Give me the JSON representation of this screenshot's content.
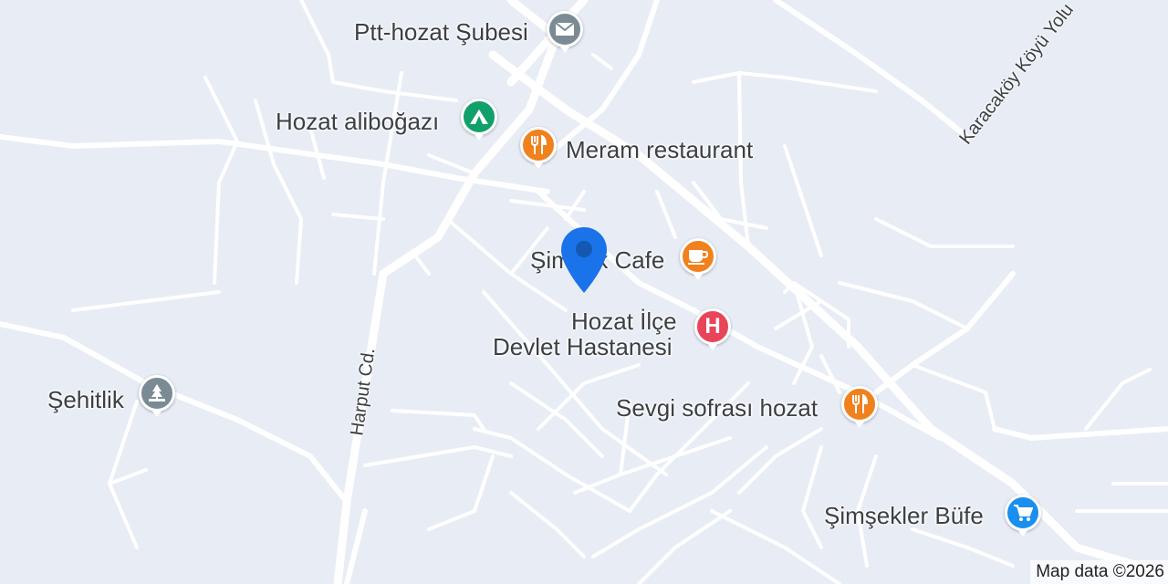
{
  "map": {
    "background": "#e8ecf5",
    "road_color": "#ffffff",
    "attribution": "Map data ©2026"
  },
  "roads": {
    "harput": "Harput Cd.",
    "karacakoy": "Karacaköy Köyü Yolu"
  },
  "pois": [
    {
      "name": "Ptt-hozat Şubesi",
      "icon": "mail-icon",
      "color": "#7b8b96"
    },
    {
      "name": "Hozat aliboğazı",
      "icon": "campground-icon",
      "color": "#12a06a"
    },
    {
      "name": "Meram restaurant",
      "icon": "restaurant-icon",
      "color": "#f0811c"
    },
    {
      "name": "Şimşek Cafe",
      "icon": "cafe-icon",
      "color": "#f0811c"
    },
    {
      "name_line1": "Hozat İlçe",
      "name_line2": "Devlet Hastanesi",
      "icon": "hospital-icon",
      "color": "#e8445a"
    },
    {
      "name": "Şehitlik",
      "icon": "cemetery-icon",
      "color": "#7b8b96"
    },
    {
      "name": "Sevgi sofrası hozat",
      "icon": "restaurant-icon",
      "color": "#f0811c"
    },
    {
      "name": "Şimşekler Büfe",
      "icon": "shopping-cart-icon",
      "color": "#1a8ff0"
    }
  ],
  "pin": {
    "icon": "location-pin-icon",
    "color": "#1a73e8"
  }
}
